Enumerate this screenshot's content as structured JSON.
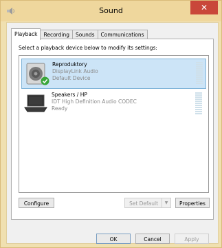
{
  "window": {
    "title": "Sound",
    "close_glyph": "✕"
  },
  "tabs": [
    {
      "label": "Playback",
      "active": true
    },
    {
      "label": "Recording",
      "active": false
    },
    {
      "label": "Sounds",
      "active": false
    },
    {
      "label": "Communications",
      "active": false
    }
  ],
  "instruction": "Select a playback device below to modify its settings:",
  "devices": [
    {
      "name": "Reproduktory",
      "description": "DisplayLink Audio",
      "status": "Default Device",
      "icon": "speaker-icon",
      "selected": true,
      "badge": "default-check-icon"
    },
    {
      "name": "Speakers / HP",
      "description": "IDT High Definition Audio CODEC",
      "status": "Ready",
      "icon": "laptop-speaker-icon",
      "selected": false
    }
  ],
  "buttons": {
    "configure": "Configure",
    "set_default": "Set Default",
    "properties": "Properties",
    "ok": "OK",
    "cancel": "Cancel",
    "apply": "Apply"
  },
  "colors": {
    "titlebar": "#efd79d",
    "close": "#c9473a",
    "selection": "#cce4f7",
    "check": "#3aa63a"
  }
}
